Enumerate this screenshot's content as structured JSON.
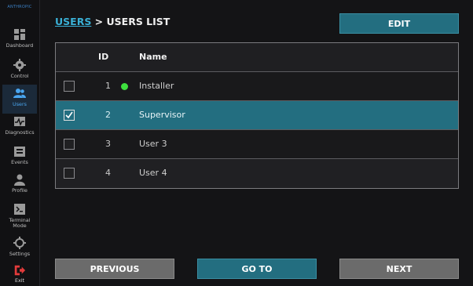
{
  "brand": {
    "text": "ANTHROPIC"
  },
  "sidebar": {
    "items": [
      {
        "label": "Dashboard",
        "icon": "dashboard-icon"
      },
      {
        "label": "Control",
        "icon": "gear-icon"
      },
      {
        "label": "Users",
        "icon": "users-icon",
        "active": true
      },
      {
        "label": "Diagnostics",
        "icon": "diagnostics-icon"
      },
      {
        "label": "Events",
        "icon": "events-icon"
      },
      {
        "label": "Profile",
        "icon": "profile-icon"
      },
      {
        "label": "Terminal Mode",
        "icon": "terminal-icon"
      },
      {
        "label": "Settings",
        "icon": "settings-icon"
      },
      {
        "label": "Exit",
        "icon": "exit-icon"
      }
    ]
  },
  "header": {
    "breadcrumb_link": "USERS",
    "breadcrumb_separator": " > ",
    "breadcrumb_current": "USERS LIST",
    "edit_label": "EDIT"
  },
  "table": {
    "columns": {
      "id": "ID",
      "name": "Name"
    },
    "rows": [
      {
        "id": "1",
        "name": "Installer",
        "checked": false,
        "online": true
      },
      {
        "id": "2",
        "name": "Supervisor",
        "checked": true,
        "online": false
      },
      {
        "id": "3",
        "name": "User 3",
        "checked": false,
        "online": false
      },
      {
        "id": "4",
        "name": "User 4",
        "checked": false,
        "online": false
      }
    ]
  },
  "footer": {
    "previous_label": "PREVIOUS",
    "goto_label": "GO TO",
    "next_label": "NEXT"
  },
  "colors": {
    "accent_teal": "#236e80",
    "link_blue": "#3ab0d6",
    "online_green": "#3ee03e",
    "exit_red": "#e23b3b"
  }
}
